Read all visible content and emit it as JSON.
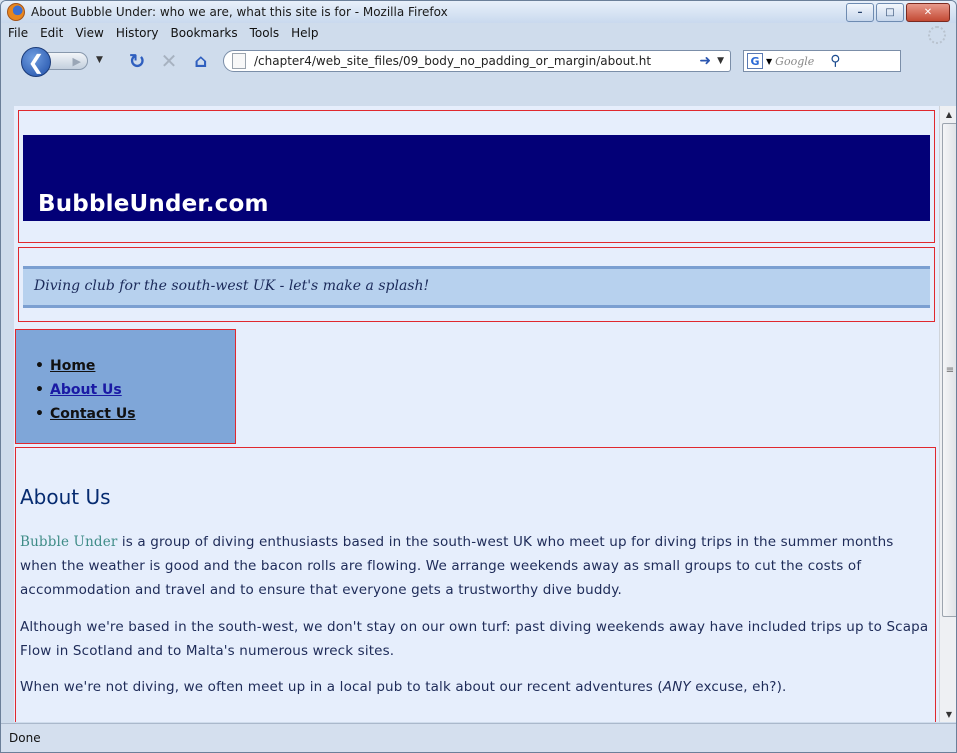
{
  "window": {
    "title": "About Bubble Under: who we are, what this site is for - Mozilla Firefox",
    "controls": {
      "minimize": "–",
      "maximize": "□",
      "close": "✕"
    }
  },
  "menu": [
    "File",
    "Edit",
    "View",
    "History",
    "Bookmarks",
    "Tools",
    "Help"
  ],
  "toolbar": {
    "back_icon": "back-arrow-icon",
    "url": "/chapter4/web_site_files/09_body_no_padding_or_margin/about.ht",
    "search_placeholder": "Google",
    "search_engine_glyph": "G"
  },
  "page": {
    "site_name": "BubbleUnder.com",
    "tagline": "Diving club for the south-west UK - let's make a splash!",
    "nav": [
      {
        "label": "Home"
      },
      {
        "label": "About Us"
      },
      {
        "label": "Contact Us"
      }
    ],
    "heading": "About Us",
    "p1_brand": "Bubble Under",
    "p1_text": " is a group of diving enthusiasts based in the south-west UK who meet up for diving trips in the summer months when the weather is good and the bacon rolls are flowing. We arrange weekends away as small groups to cut the costs of accommodation and travel and to ensure that everyone gets a trustworthy dive buddy.",
    "p2": "Although we're based in the south-west, we don't stay on our own turf: past diving weekends away have included trips up to Scapa Flow in Scotland and to Malta's numerous wreck sites.",
    "p3_before": "When we're not diving, we often meet up in a local pub to talk about our recent adventures (",
    "p3_any": "ANY",
    "p3_after": " excuse, eh?)."
  },
  "status": "Done",
  "colors": {
    "header_band": "#030077",
    "tag_band": "#b7d1ee",
    "nav_bg": "#7fa6d8",
    "page_bg": "#e6eefc",
    "debug_border": "#e0282e"
  }
}
